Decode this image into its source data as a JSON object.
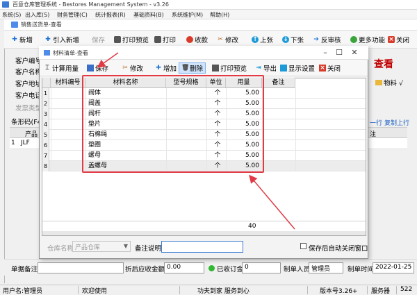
{
  "app": {
    "title": "百意仓库管理系统 - Bestores Management System - v3.26",
    "menu": [
      "系统(S)",
      "出入库(S)",
      "财务管理(C)",
      "统计报表(R)",
      "基础资料(B)",
      "系统维护(M)",
      "帮助(H)"
    ]
  },
  "sales_window": {
    "title": "销售送货单-查看",
    "toolbar": {
      "add": "新增",
      "import_add": "引入新增",
      "save": "保存",
      "print_preview": "打印预览",
      "print": "打印",
      "receive": "收款",
      "edit": "修改",
      "prev": "上张",
      "next": "下张",
      "unaudit": "反审核",
      "more": "更多功能",
      "close": "关闭"
    },
    "view_mark": "查看",
    "form_labels": {
      "customer_no": "客户编号",
      "customer_name": "客户名称",
      "customer_address": "客户地址",
      "customer_phone": "客户电话",
      "shipping_type": "发票类型",
      "barcode": "条形码(F4)"
    },
    "materials_label": "物料 √",
    "line_buttons": {
      "row": "一行",
      "copy_up": "复制上行"
    },
    "back_grid": {
      "header_product": "产品",
      "header_note": "注",
      "row_num": "1",
      "row_code": "JLF"
    },
    "bottom": {
      "note_label": "单据备注",
      "discount_label": "折后应收金额",
      "discount_value": "0.00",
      "received_label": "已收订金",
      "received_value": "0",
      "maker_label": "制单人员",
      "maker_value": "管理员",
      "time_label": "制单时间",
      "time_value": "2022-01-25"
    }
  },
  "status_bar": {
    "user": "用户名:管理员",
    "trial": "欢迎使用",
    "slogan": "功夫到家 服务到心",
    "version": "版本号3.26+",
    "server": "服务器",
    "tail": "522"
  },
  "dialog": {
    "title": "材料清单-查看",
    "toolbar": {
      "calc": "计算用量",
      "save": "保存",
      "edit": "修改",
      "add": "增加",
      "delete": "删除",
      "print_preview": "打印预览",
      "export": "导出",
      "display": "显示设置",
      "close": "关闭"
    },
    "table": {
      "headers": [
        "材料编号",
        "材料名称",
        "型号规格",
        "单位",
        "用量",
        "备注"
      ],
      "rows": [
        {
          "num": "1",
          "code": "",
          "name": "阀体",
          "spec": "",
          "unit": "个",
          "qty": "5.00",
          "note": ""
        },
        {
          "num": "2",
          "code": "",
          "name": "阀盖",
          "spec": "",
          "unit": "个",
          "qty": "5.00",
          "note": ""
        },
        {
          "num": "3",
          "code": "",
          "name": "阀杆",
          "spec": "",
          "unit": "个",
          "qty": "5.00",
          "note": ""
        },
        {
          "num": "4",
          "code": "",
          "name": "垫片",
          "spec": "",
          "unit": "个",
          "qty": "5.00",
          "note": ""
        },
        {
          "num": "5",
          "code": "",
          "name": "石棉绳",
          "spec": "",
          "unit": "个",
          "qty": "5.00",
          "note": ""
        },
        {
          "num": "6",
          "code": "",
          "name": "垫圈",
          "spec": "",
          "unit": "个",
          "qty": "5.00",
          "note": ""
        },
        {
          "num": "7",
          "code": "",
          "name": "螺母",
          "spec": "",
          "unit": "个",
          "qty": "5.00",
          "note": ""
        },
        {
          "num": "8",
          "code": "",
          "name": "盖螺母",
          "spec": "",
          "unit": "个",
          "qty": "5.00",
          "note": ""
        }
      ],
      "total": "40"
    },
    "bottom": {
      "warehouse_label": "仓库名称",
      "warehouse_value": "产品仓库",
      "note_label": "备注说明",
      "note_value": "",
      "auto_close_label": "保存后自动关闭窗口"
    }
  },
  "colors": {
    "highlight": "#e23b46",
    "view_mark": "#c00000",
    "accent": "#3a7bd5"
  }
}
